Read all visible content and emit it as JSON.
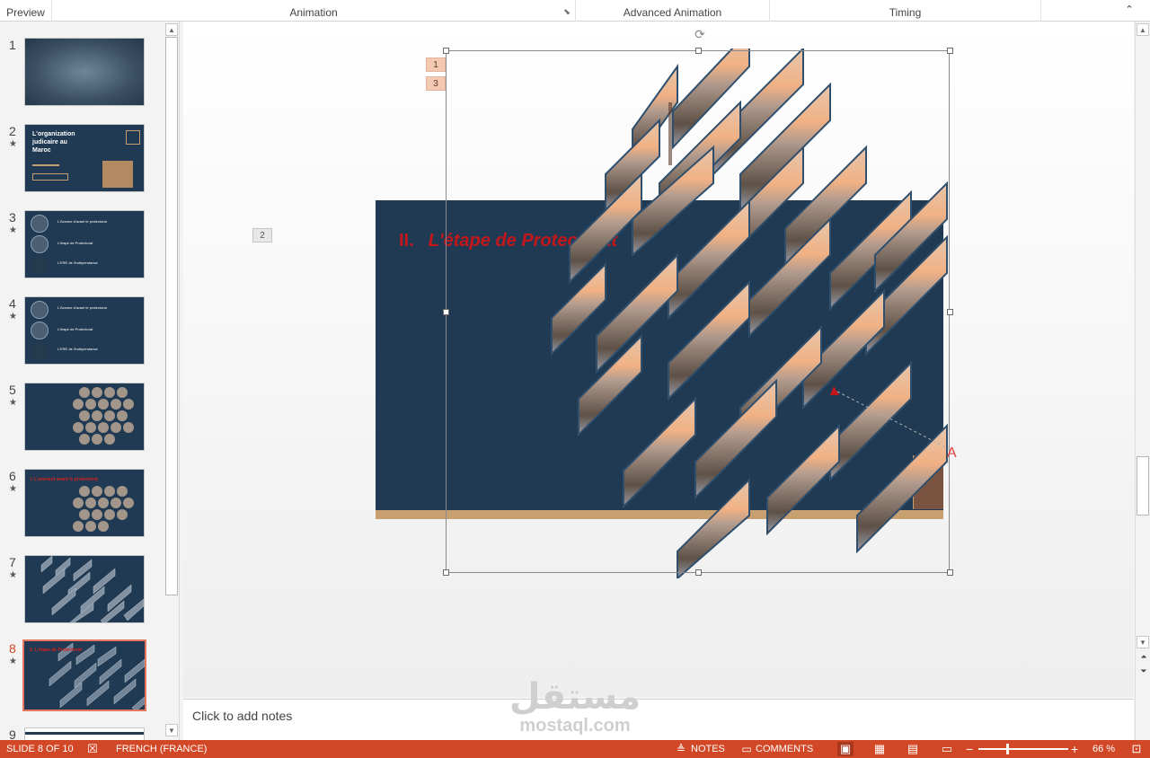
{
  "ribbon": {
    "groups": [
      {
        "label": "Preview"
      },
      {
        "label": "Animation"
      },
      {
        "label": "Advanced Animation"
      },
      {
        "label": "Timing"
      }
    ],
    "dialog_launcher_icon": "dialog-launcher-icon",
    "collapse_icon": "chevron-up-icon"
  },
  "thumbnails": {
    "slides": [
      {
        "number": "1",
        "animated": false,
        "title": ""
      },
      {
        "number": "2",
        "animated": true,
        "title": "L'organization judicaire au Maroc"
      },
      {
        "number": "3",
        "animated": true,
        "lines": [
          "L'Avenue d'avant le protectorat",
          "L'étape de Protectorat",
          "L'ERE de l'indépendance"
        ]
      },
      {
        "number": "4",
        "animated": true,
        "lines": [
          "L'Avenue d'avant le protectorat",
          "L'étape de Protectorat",
          "L'ERE de l'indépendance"
        ]
      },
      {
        "number": "5",
        "animated": true
      },
      {
        "number": "6",
        "animated": true,
        "title": "I. L'avenant avant le protectorat"
      },
      {
        "number": "7",
        "animated": true
      },
      {
        "number": "8",
        "animated": true,
        "title": "II. L'étape de Protectorat"
      },
      {
        "number": "9",
        "animated": false
      }
    ],
    "star_glyph": "★",
    "active_index": 7
  },
  "slide": {
    "title_number": "II.",
    "title_text": "L'étape de Protectorat",
    "anim_tags": [
      "1",
      "3"
    ],
    "anim_tag_outside": "2",
    "colors": {
      "background": "#1f3a52",
      "title": "#c3171b",
      "bottom_bar": "#c79f70"
    }
  },
  "notes": {
    "placeholder": "Click to add notes"
  },
  "watermark": {
    "arabic": "مستقل",
    "latin": "mostaql.com"
  },
  "statusbar": {
    "slide_info": "SLIDE 8 OF 10",
    "language": "FRENCH (FRANCE)",
    "notes_label": "NOTES",
    "comments_label": "COMMENTS",
    "zoom": "66 %",
    "zoom_out": "−",
    "zoom_in": "+",
    "accent": "#d24726"
  }
}
